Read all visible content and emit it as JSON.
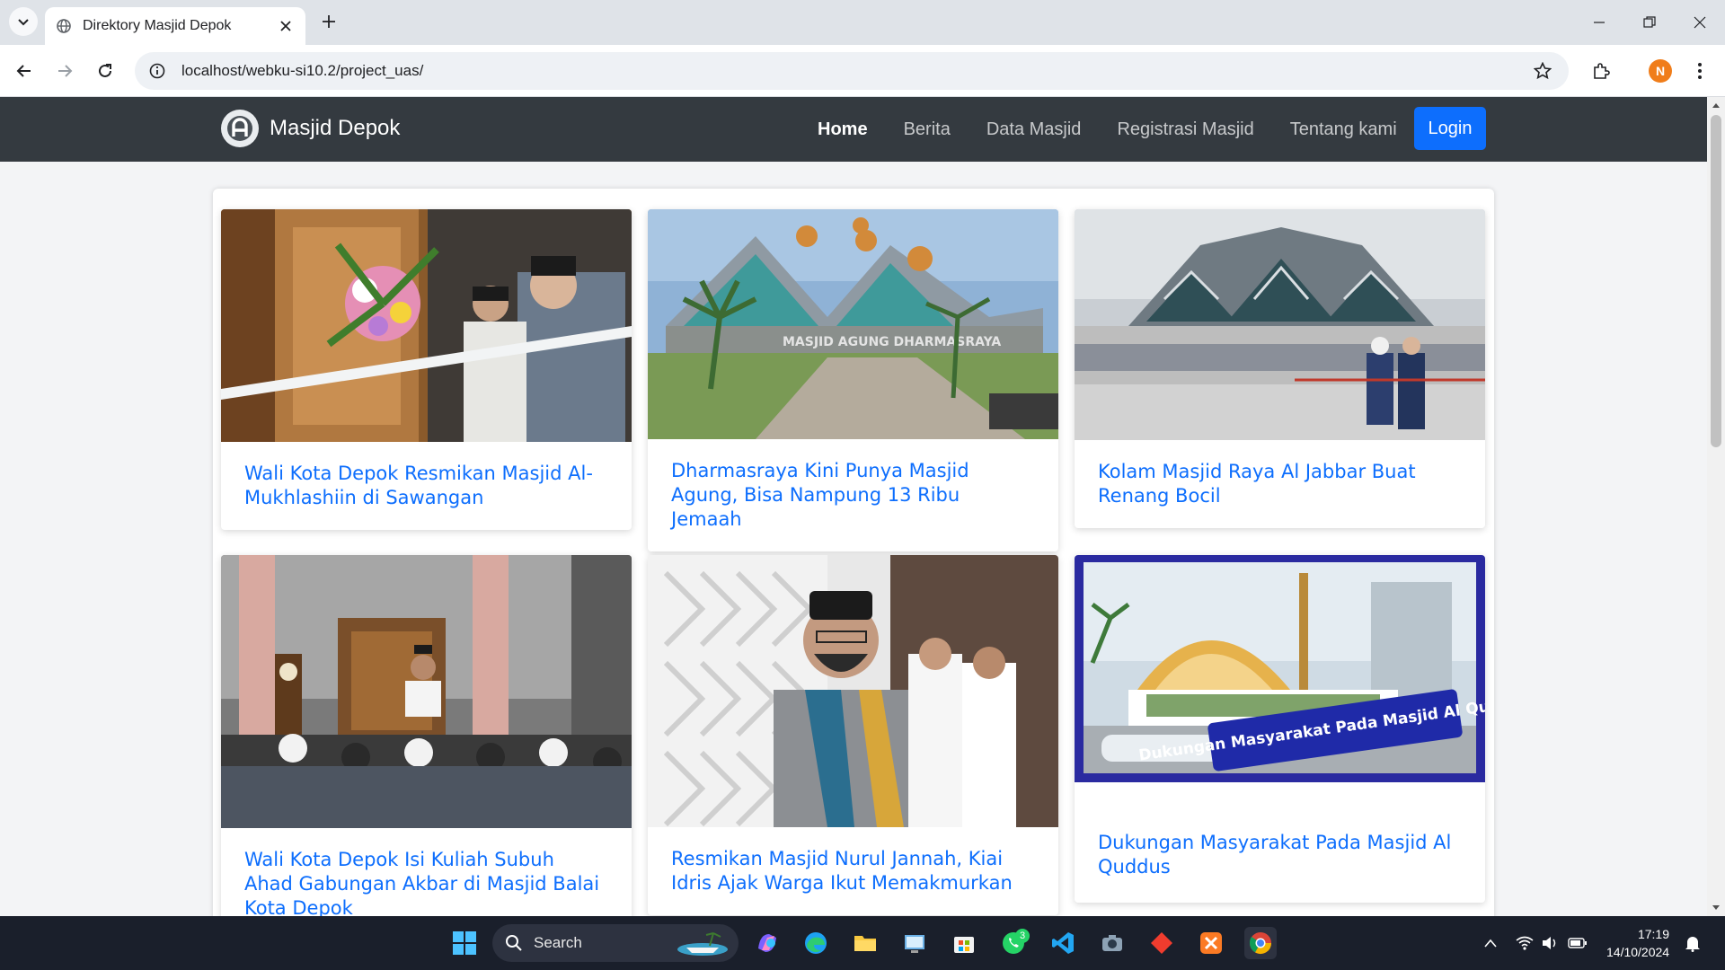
{
  "browser": {
    "tab_title": "Direktory Masjid Depok",
    "url": "localhost/webku-si10.2/project_uas/",
    "profile_initial": "N"
  },
  "site": {
    "brand": "Masjid Depok",
    "nav": [
      {
        "label": "Home",
        "active": true
      },
      {
        "label": "Berita",
        "active": false
      },
      {
        "label": "Data Masjid",
        "active": false
      },
      {
        "label": "Registrasi Masjid",
        "active": false
      },
      {
        "label": "Tentang kami",
        "active": false
      }
    ],
    "login_label": "Login"
  },
  "articles": [
    {
      "title": "Wali Kota Depok Resmikan Masjid Al-Mukhlashiin di Sawangan",
      "image": "ribbon-cutting-photo"
    },
    {
      "title": "Dharmasraya Kini Punya Masjid Agung, Bisa Nampung 13 Ribu Jemaah",
      "image": "masjid-agung-photo",
      "image_text": "MASJID AGUNG DHARMASRAYA"
    },
    {
      "title": "Kolam Masjid Raya Al Jabbar Buat Renang Bocil",
      "image": "al-jabbar-photo"
    },
    {
      "title": "Wali Kota Depok Isi Kuliah Subuh Ahad Gabungan Akbar di Masjid Balai Kota Depok",
      "image": "sermon-photo"
    },
    {
      "title": "Resmikan Masjid Nurul Jannah, Kiai Idris Ajak Warga Ikut Memakmurkan",
      "image": "kiai-portrait-photo"
    },
    {
      "title": "Dukungan Masyarakat Pada Masjid Al Quddus",
      "image": "al-quddus-render",
      "image_text": "Dukungan Masyarakat Pada Masjid Al Quddus"
    }
  ],
  "taskbar": {
    "search_label": "Search",
    "whatsapp_badge": "3",
    "time": "17:19",
    "date": "14/10/2024"
  }
}
